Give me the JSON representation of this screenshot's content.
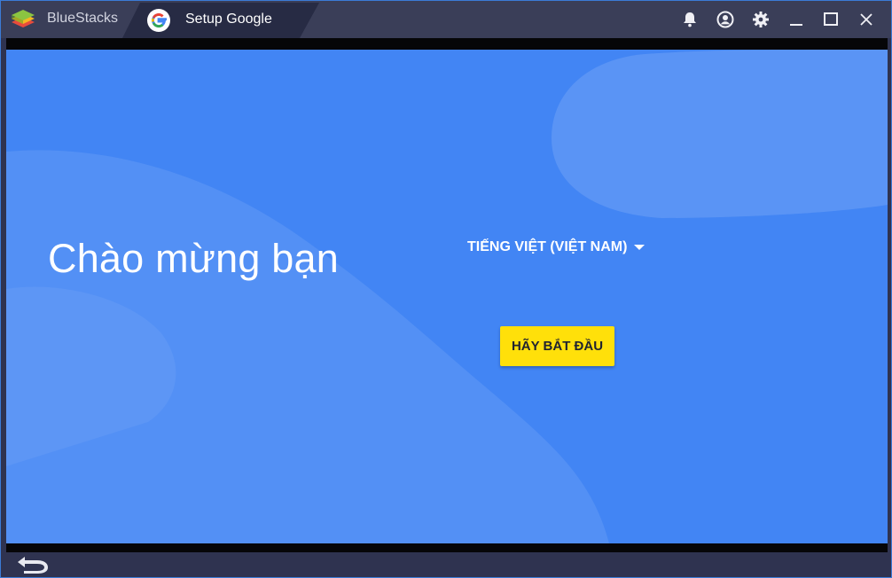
{
  "titlebar": {
    "home_tab_label": "BlueStacks",
    "active_tab_label": "Setup Google",
    "controls": [
      "bell-icon",
      "account-icon",
      "gear-icon",
      "minimize-icon",
      "maximize-icon",
      "close-icon"
    ]
  },
  "screen": {
    "welcome_title": "Chào mừng bạn",
    "language_selector": "TIẾNG VIỆT (VIỆT NAM)",
    "start_button": "HÃY BẮT ĐẦU"
  },
  "colors": {
    "titlebar": "#3a3e58",
    "active_tab": "#272b44",
    "screen_background": "#4285f4",
    "start_button": "#ffe00a"
  }
}
